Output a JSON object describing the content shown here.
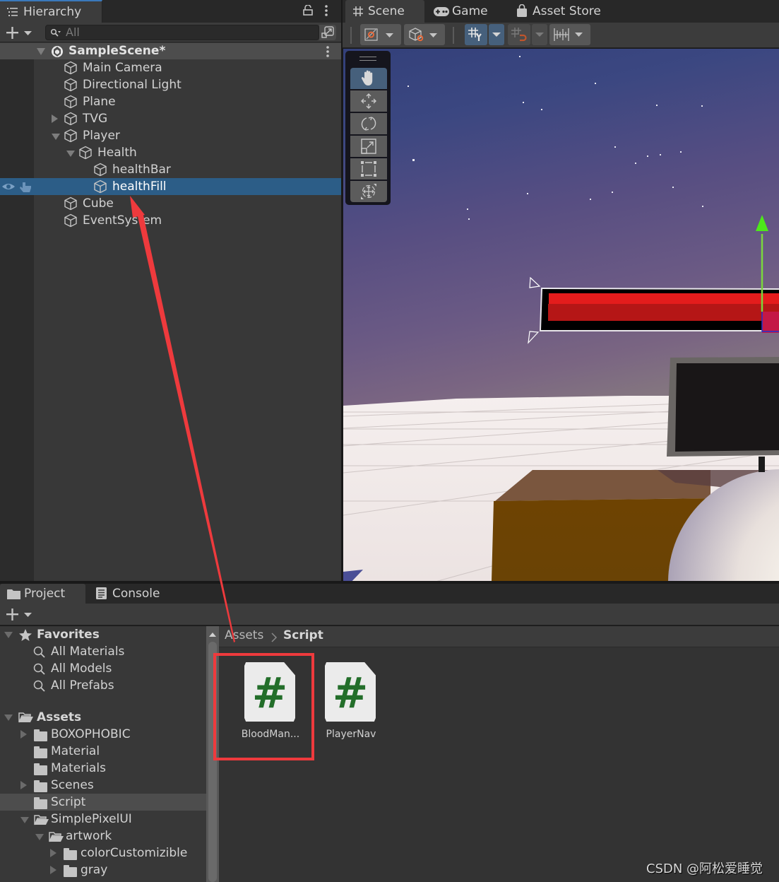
{
  "hierarchy": {
    "tab_label": "Hierarchy",
    "search_placeholder": "All",
    "scene_name": "SampleScene*",
    "items": [
      {
        "label": "Main Camera"
      },
      {
        "label": "Directional Light"
      },
      {
        "label": "Plane"
      },
      {
        "label": "TVG",
        "expander": "collapsed"
      },
      {
        "label": "Player",
        "expander": "expanded"
      },
      {
        "label": "Health",
        "expander": "expanded"
      },
      {
        "label": "healthBar"
      },
      {
        "label": "healthFill",
        "selected": true
      },
      {
        "label": "Cube"
      },
      {
        "label": "EventSystem"
      }
    ]
  },
  "scene_view": {
    "tabs": [
      {
        "label": "Scene",
        "icon": "grid-icon",
        "active": true
      },
      {
        "label": "Game",
        "icon": "gamepad-icon"
      },
      {
        "label": "Asset Store",
        "icon": "shopping-bag-icon"
      }
    ],
    "tools": [
      "hand-tool",
      "move-tool",
      "rotate-tool",
      "scale-tool",
      "rect-tool",
      "transform-tool"
    ],
    "active_tool": "hand-tool",
    "colors": {
      "health_fill": "#e51c1c",
      "health_fill_dark": "#b61616",
      "gizmo_y": "#7ae03a",
      "cube": "#6c4203"
    }
  },
  "project": {
    "tabs": [
      {
        "label": "Project",
        "icon": "folder-icon",
        "active": true
      },
      {
        "label": "Console",
        "icon": "console-icon"
      }
    ],
    "favorites": {
      "label": "Favorites",
      "items": [
        "All Materials",
        "All Models",
        "All Prefabs"
      ]
    },
    "assets": {
      "label": "Assets",
      "items": [
        {
          "label": "BOXOPHOBIC",
          "expander": "collapsed"
        },
        {
          "label": "Material"
        },
        {
          "label": "Materials"
        },
        {
          "label": "Scenes",
          "expander": "collapsed"
        },
        {
          "label": "Script",
          "selected": true
        },
        {
          "label": "SimplePixelUI",
          "expander": "expanded"
        },
        {
          "label": "artwork",
          "expander": "expanded"
        },
        {
          "label": "colorCustomizible",
          "expander": "collapsed"
        },
        {
          "label": "gray",
          "expander": "collapsed"
        }
      ]
    },
    "breadcrumb": [
      "Assets",
      "Script"
    ],
    "files": [
      {
        "label": "BloodMan...",
        "type": "C# script",
        "highlighted": true
      },
      {
        "label": "PlayerNav",
        "type": "C# script"
      }
    ]
  },
  "annotation": {
    "color": "#ee3a3d"
  },
  "watermark": "CSDN @阿松爱睡觉"
}
